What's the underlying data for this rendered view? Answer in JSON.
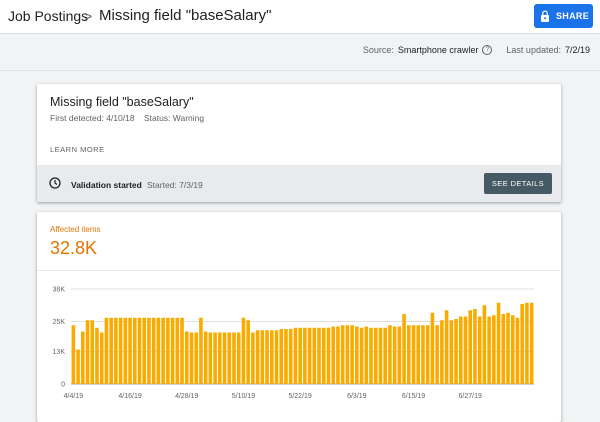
{
  "header": {
    "breadcrumb_root": "Job Postings",
    "breadcrumb_sep": ">",
    "title": "Missing field \"baseSalary\"",
    "share_label": "SHARE"
  },
  "meta": {
    "source_label": "Source:",
    "source_value": "Smartphone crawler",
    "help_glyph": "?",
    "updated_label": "Last updated:",
    "updated_value": "7/2/19"
  },
  "issue": {
    "title": "Missing field \"baseSalary\"",
    "first_detected": "First detected: 4/10/18",
    "status": "Status: Warning",
    "learn_more": "LEARN MORE",
    "validation_label": "Validation started",
    "validation_started": "Started: 7/3/19",
    "details_label": "SEE DETAILS"
  },
  "affected": {
    "label": "Affected items",
    "value": "32.8K"
  },
  "colors": {
    "accent": "#1a73e8",
    "bar": "#f9ab00",
    "orange_text": "#e37400",
    "details_btn": "#455a64"
  },
  "chart_data": {
    "type": "bar",
    "ylim": [
      0,
      38000
    ],
    "yticks": [
      0,
      13000,
      25000,
      38000
    ],
    "ytick_labels": [
      "0",
      "13K",
      "25K",
      "38K"
    ],
    "xtick_labels": [
      "4/4/19",
      "4/16/19",
      "4/28/19",
      "5/10/19",
      "5/22/19",
      "6/3/19",
      "6/15/19",
      "6/27/19"
    ],
    "xtick_indices": [
      0,
      12,
      24,
      36,
      48,
      60,
      72,
      84
    ],
    "values": [
      23500,
      13800,
      21000,
      25500,
      25500,
      22500,
      20600,
      26500,
      26500,
      26500,
      26500,
      26500,
      26500,
      26500,
      26500,
      26500,
      26500,
      26500,
      26500,
      26500,
      26500,
      26500,
      26500,
      26500,
      21000,
      20600,
      20600,
      26500,
      21000,
      20600,
      20600,
      20600,
      20600,
      20600,
      20600,
      20600,
      26500,
      25500,
      20600,
      21500,
      21500,
      21500,
      21500,
      21500,
      22000,
      22000,
      22000,
      22500,
      22500,
      22500,
      22500,
      22500,
      22500,
      22500,
      22500,
      23000,
      23000,
      23500,
      23500,
      23500,
      23000,
      22500,
      23000,
      22500,
      22500,
      22500,
      22500,
      23500,
      23000,
      23000,
      28000,
      23500,
      23500,
      23500,
      23500,
      23500,
      28500,
      23500,
      25500,
      29500,
      25500,
      26000,
      27000,
      27000,
      29500,
      30000,
      27000,
      31500,
      27000,
      27500,
      32500,
      28000,
      28500,
      27500,
      26500,
      32000,
      32500,
      32500
    ]
  },
  "chart": {
    "name": "affected-items-chart"
  }
}
